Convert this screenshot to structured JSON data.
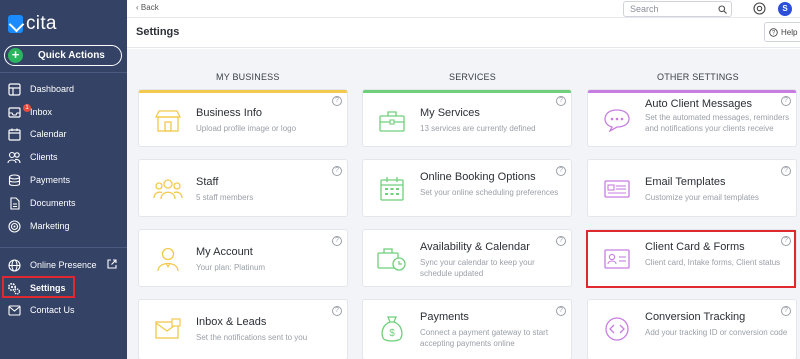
{
  "brand": {
    "name": "cita"
  },
  "sidebar": {
    "quick_actions": "Quick Actions",
    "items": [
      {
        "label": "Dashboard",
        "icon": "dashboard-icon"
      },
      {
        "label": "Inbox",
        "icon": "inbox-icon",
        "badge": "1"
      },
      {
        "label": "Calendar",
        "icon": "calendar-icon"
      },
      {
        "label": "Clients",
        "icon": "clients-icon"
      },
      {
        "label": "Payments",
        "icon": "payments-icon"
      },
      {
        "label": "Documents",
        "icon": "documents-icon"
      },
      {
        "label": "Marketing",
        "icon": "marketing-icon"
      },
      {
        "label": "Online Presence",
        "icon": "globe-icon"
      },
      {
        "label": "Settings",
        "icon": "gears-icon",
        "active": true
      },
      {
        "label": "Contact Us",
        "icon": "mail-icon"
      }
    ]
  },
  "topbar": {
    "back": "Back",
    "search_placeholder": "Search",
    "avatar": "S"
  },
  "header": {
    "title": "Settings",
    "help": "Help"
  },
  "columns": [
    "MY BUSINESS",
    "SERVICES",
    "OTHER SETTINGS"
  ],
  "colors": {
    "business": "#f2c94c",
    "services": "#6fcf7a",
    "other": "#c77ee0",
    "sidebar": "#344266",
    "highlight": "#e0292f"
  },
  "cards": {
    "business_info": {
      "title": "Business Info",
      "desc": "Upload profile image or logo"
    },
    "staff": {
      "title": "Staff",
      "desc": "5 staff members"
    },
    "my_account": {
      "title": "My Account",
      "desc": "Your plan: Platinum"
    },
    "inbox_leads": {
      "title": "Inbox & Leads",
      "desc": "Set the notifications sent to you"
    },
    "my_services": {
      "title": "My Services",
      "desc": "13 services are currently defined"
    },
    "online_booking": {
      "title": "Online Booking Options",
      "desc": "Set your online scheduling preferences"
    },
    "availability": {
      "title": "Availability & Calendar",
      "desc": "Sync your calendar to keep your schedule updated"
    },
    "payments": {
      "title": "Payments",
      "desc": "Connect a payment gateway to start accepting payments online"
    },
    "auto_messages": {
      "title": "Auto Client Messages",
      "desc": "Set the automated messages, reminders and notifications your clients receive"
    },
    "email_templates": {
      "title": "Email Templates",
      "desc": "Customize your email templates"
    },
    "client_card": {
      "title": "Client Card & Forms",
      "desc": "Client card, Intake forms, Client status"
    },
    "conversion": {
      "title": "Conversion Tracking",
      "desc": "Add your tracking ID or conversion code"
    }
  },
  "qmark": "?"
}
